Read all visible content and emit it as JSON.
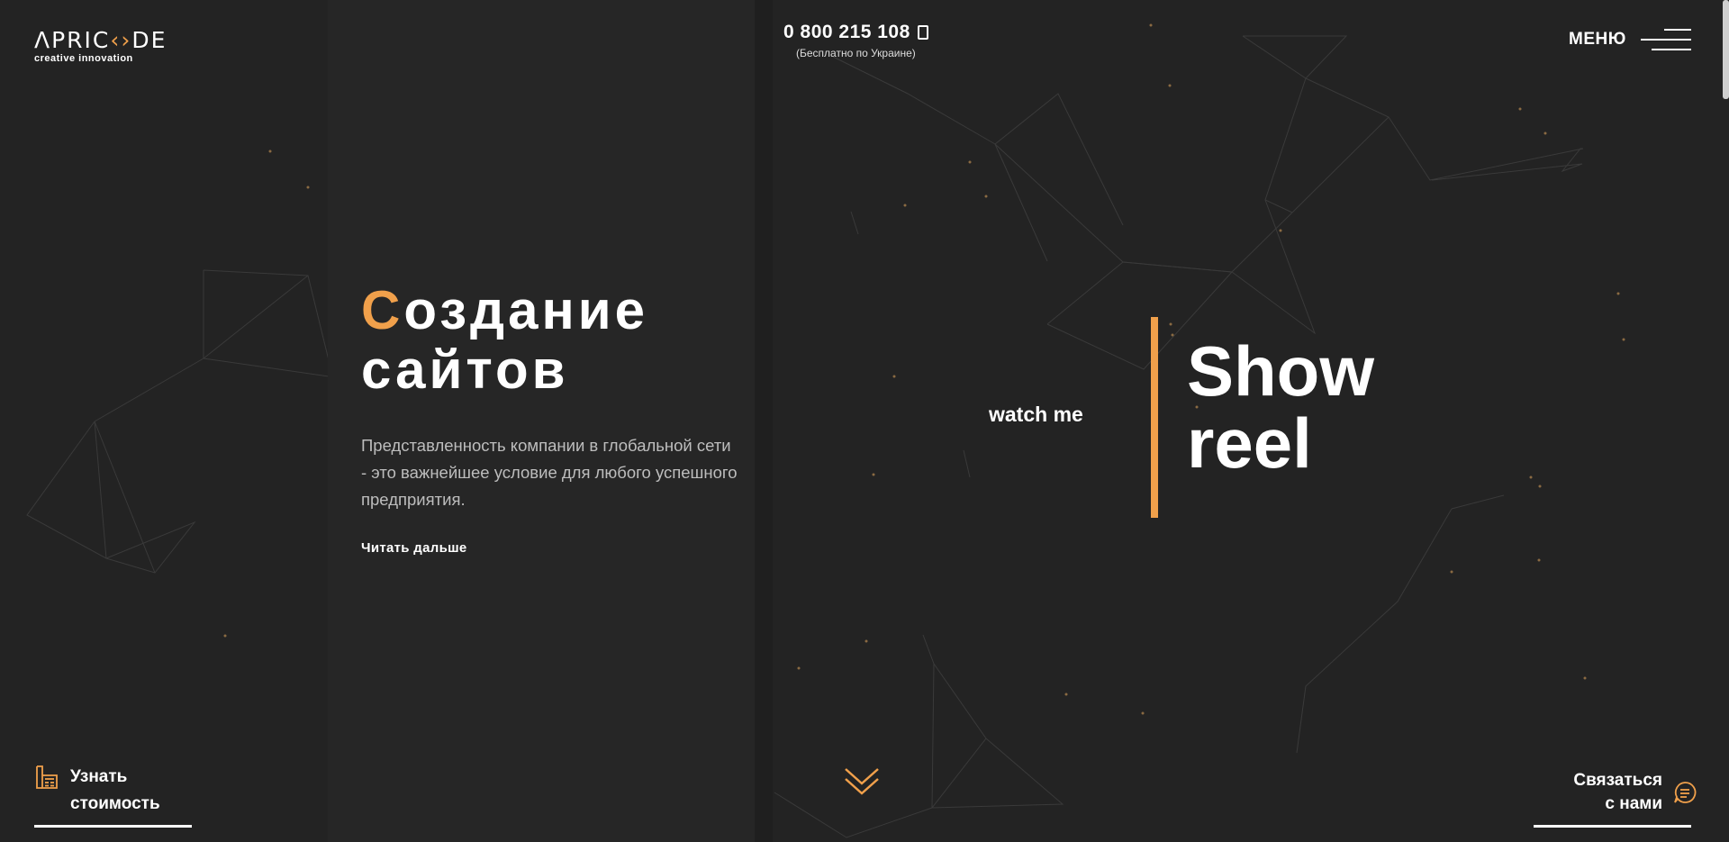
{
  "logo": {
    "main_pre": "ΛPRIC",
    "main_accent": "‹›",
    "main_post": "DE",
    "tagline": "creative innovation"
  },
  "header": {
    "phone": "0 800 215 108",
    "phone_note": "(Бесплатно по Украине)",
    "menu_label": "МЕНЮ"
  },
  "hero": {
    "title_first_letter": "С",
    "title_line1_rest": "оздание",
    "title_line2": "сайтов",
    "description": "Представленность компании в глобальной сети - это важнейшее условие для любого успешного предприятия.",
    "read_more": "Читать дальше"
  },
  "showreel": {
    "watch_label": "watch me",
    "line1": "Show",
    "line2": "reel"
  },
  "footer": {
    "cost_line1": "Узнать",
    "cost_line2": "стоимость",
    "contact_line1": "Связаться",
    "contact_line2": "с нами"
  },
  "colors": {
    "accent": "#f0a04b",
    "background": "#232323",
    "panel": "#262626"
  },
  "icons": {
    "phone": "phone-icon",
    "menu": "hamburger-icon",
    "cost": "calculator-icon",
    "contact": "chat-icon",
    "scroll": "double-chevron-down-icon"
  }
}
